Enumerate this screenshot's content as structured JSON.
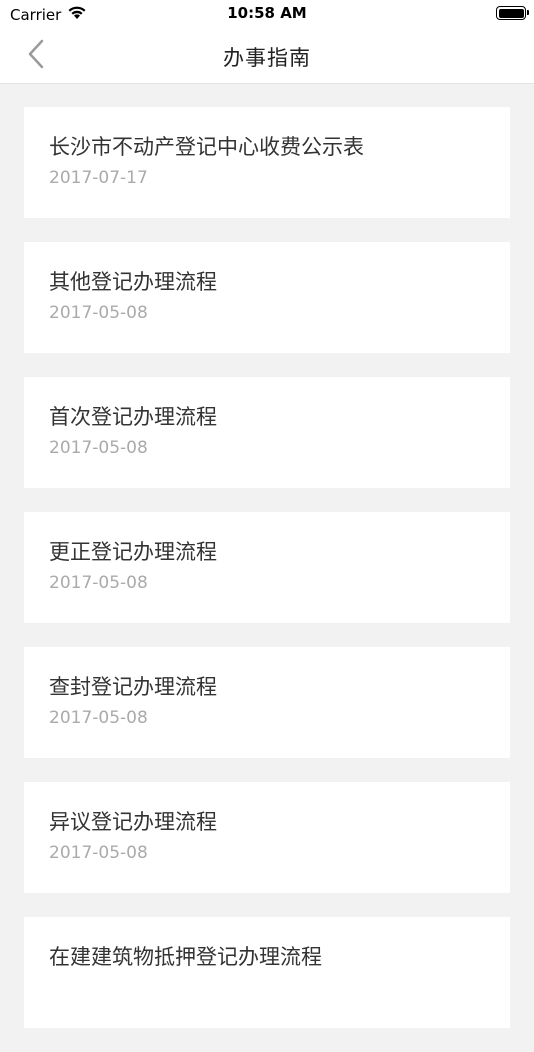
{
  "status_bar": {
    "carrier": "Carrier",
    "time": "10:58 AM"
  },
  "nav": {
    "title": "办事指南",
    "back_icon": "chevron-left-icon"
  },
  "colors": {
    "background": "#f2f2f2",
    "card": "#ffffff",
    "title_text": "#333333",
    "date_text": "#aaaaaa"
  },
  "items": [
    {
      "title": "长沙市不动产登记中心收费公示表",
      "date": "2017-07-17"
    },
    {
      "title": "其他登记办理流程",
      "date": "2017-05-08"
    },
    {
      "title": "首次登记办理流程",
      "date": "2017-05-08"
    },
    {
      "title": "更正登记办理流程",
      "date": "2017-05-08"
    },
    {
      "title": "查封登记办理流程",
      "date": "2017-05-08"
    },
    {
      "title": "异议登记办理流程",
      "date": "2017-05-08"
    },
    {
      "title": "在建建筑物抵押登记办理流程",
      "date": ""
    }
  ]
}
